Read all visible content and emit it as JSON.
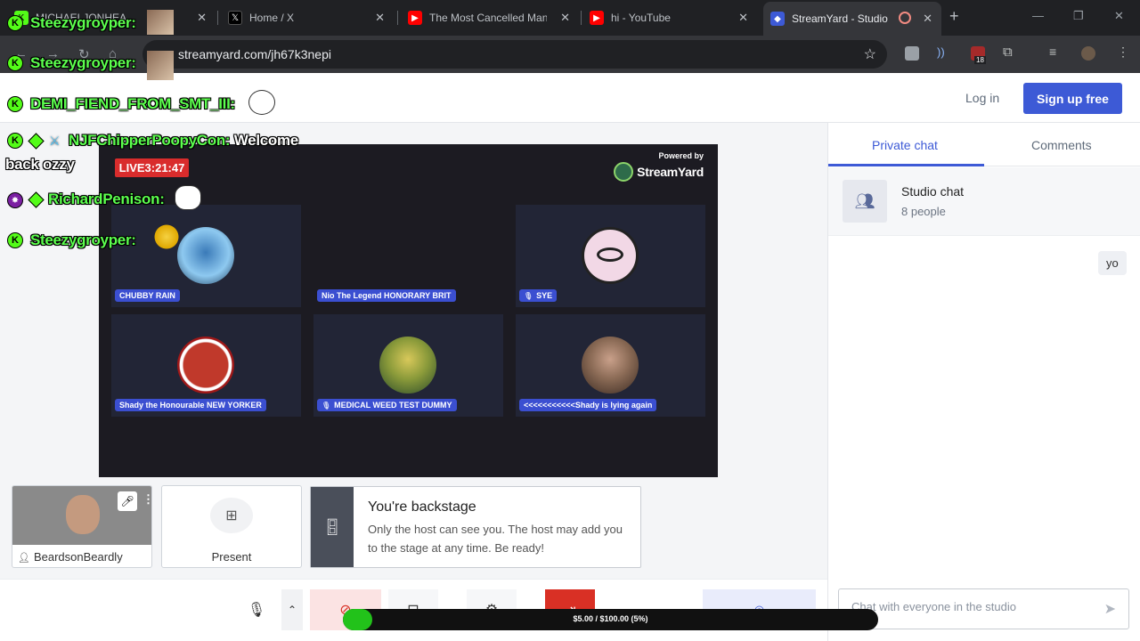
{
  "browser": {
    "tabs": [
      {
        "title": "MICHAELJONHEA",
        "favicon_color": "#53fc18"
      },
      {
        "title": "Home / X",
        "favicon_color": "#000000"
      },
      {
        "title": "The Most Cancelled Man",
        "favicon_color": "#ff0000"
      },
      {
        "title": "hi - YouTube",
        "favicon_color": "#ff0000"
      },
      {
        "title": "StreamYard - Studio",
        "favicon_color": "#3d5ad6"
      }
    ],
    "url": "streamyard.com/jh67k3nepi",
    "extension_badge": "18"
  },
  "header": {
    "login_label": "Log in",
    "signup_label": "Sign up free"
  },
  "stage": {
    "live_label": "LIVE3:21:47",
    "powered_by": "Powered by",
    "brand": "StreamYard",
    "participants": [
      {
        "name": "CHUBBY RAIN",
        "muted": false
      },
      {
        "name": "Nio The Legend HONORARY BRIT",
        "muted": false
      },
      {
        "name": "SYE",
        "muted": true
      },
      {
        "name": "Shady the Honourable NEW YORKER",
        "muted": false
      },
      {
        "name": "MEDICAL WEED TEST DUMMY",
        "muted": true
      },
      {
        "name": "<<<<<<<<<<<Shady is lying again",
        "muted": false
      }
    ]
  },
  "self_tile": {
    "name": "BeardsonBeardly"
  },
  "present_tile": {
    "label": "Present"
  },
  "backstage": {
    "title": "You're backstage",
    "description": "Only the host can see you. The host may add you to the stage at any time. Be ready!"
  },
  "right_panel": {
    "tabs": [
      "Private chat",
      "Comments"
    ],
    "chat_title": "Studio chat",
    "chat_subtitle": "8 people",
    "messages": [
      "yo"
    ],
    "input_placeholder": "Chat with everyone in the studio"
  },
  "overlay_chat": [
    {
      "user": "Steezygroyper:",
      "message": ""
    },
    {
      "user": "Steezygroyper:",
      "message": ""
    },
    {
      "user": "DEMI_FIEND_FROM_SMT_III:",
      "message": ""
    },
    {
      "user": "NJFChipperPoopyCon:",
      "message": "Welcome"
    },
    {
      "user": "",
      "message": "back ozzy"
    },
    {
      "user": "RichardPenison:",
      "message": ""
    },
    {
      "user": "Steezygroyper:",
      "message": ""
    }
  ],
  "donation_goal": {
    "text": "$5.00 / $100.00 (5%)",
    "progress": 0.05
  },
  "colors": {
    "accent": "#3d5ad6",
    "live": "#d92c2c",
    "kick_green": "#53fc18"
  }
}
